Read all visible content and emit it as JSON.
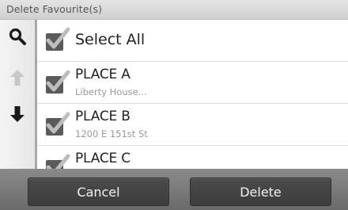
{
  "header": {
    "title": "Delete Favourite(s)"
  },
  "sidebar": {
    "buttons": [
      {
        "icon": "search-icon",
        "enabled": true
      },
      {
        "icon": "arrow-up-icon",
        "enabled": false
      },
      {
        "icon": "arrow-down-icon",
        "enabled": true
      }
    ]
  },
  "list": {
    "select_all": {
      "label": "Select All",
      "checked": true
    },
    "items": [
      {
        "name": "PLACE A",
        "address": "Liberty House...",
        "checked": true
      },
      {
        "name": "PLACE B",
        "address": "1200 E 151st St",
        "checked": true
      },
      {
        "name": "PLACE C",
        "address": "",
        "checked": true
      }
    ]
  },
  "footer": {
    "cancel_label": "Cancel",
    "delete_label": "Delete"
  },
  "colors": {
    "check_box": "#5a5a5a",
    "check_mark": "#bdbdbd",
    "bottom_bar": "#6e6e6e",
    "button": "#444444"
  }
}
